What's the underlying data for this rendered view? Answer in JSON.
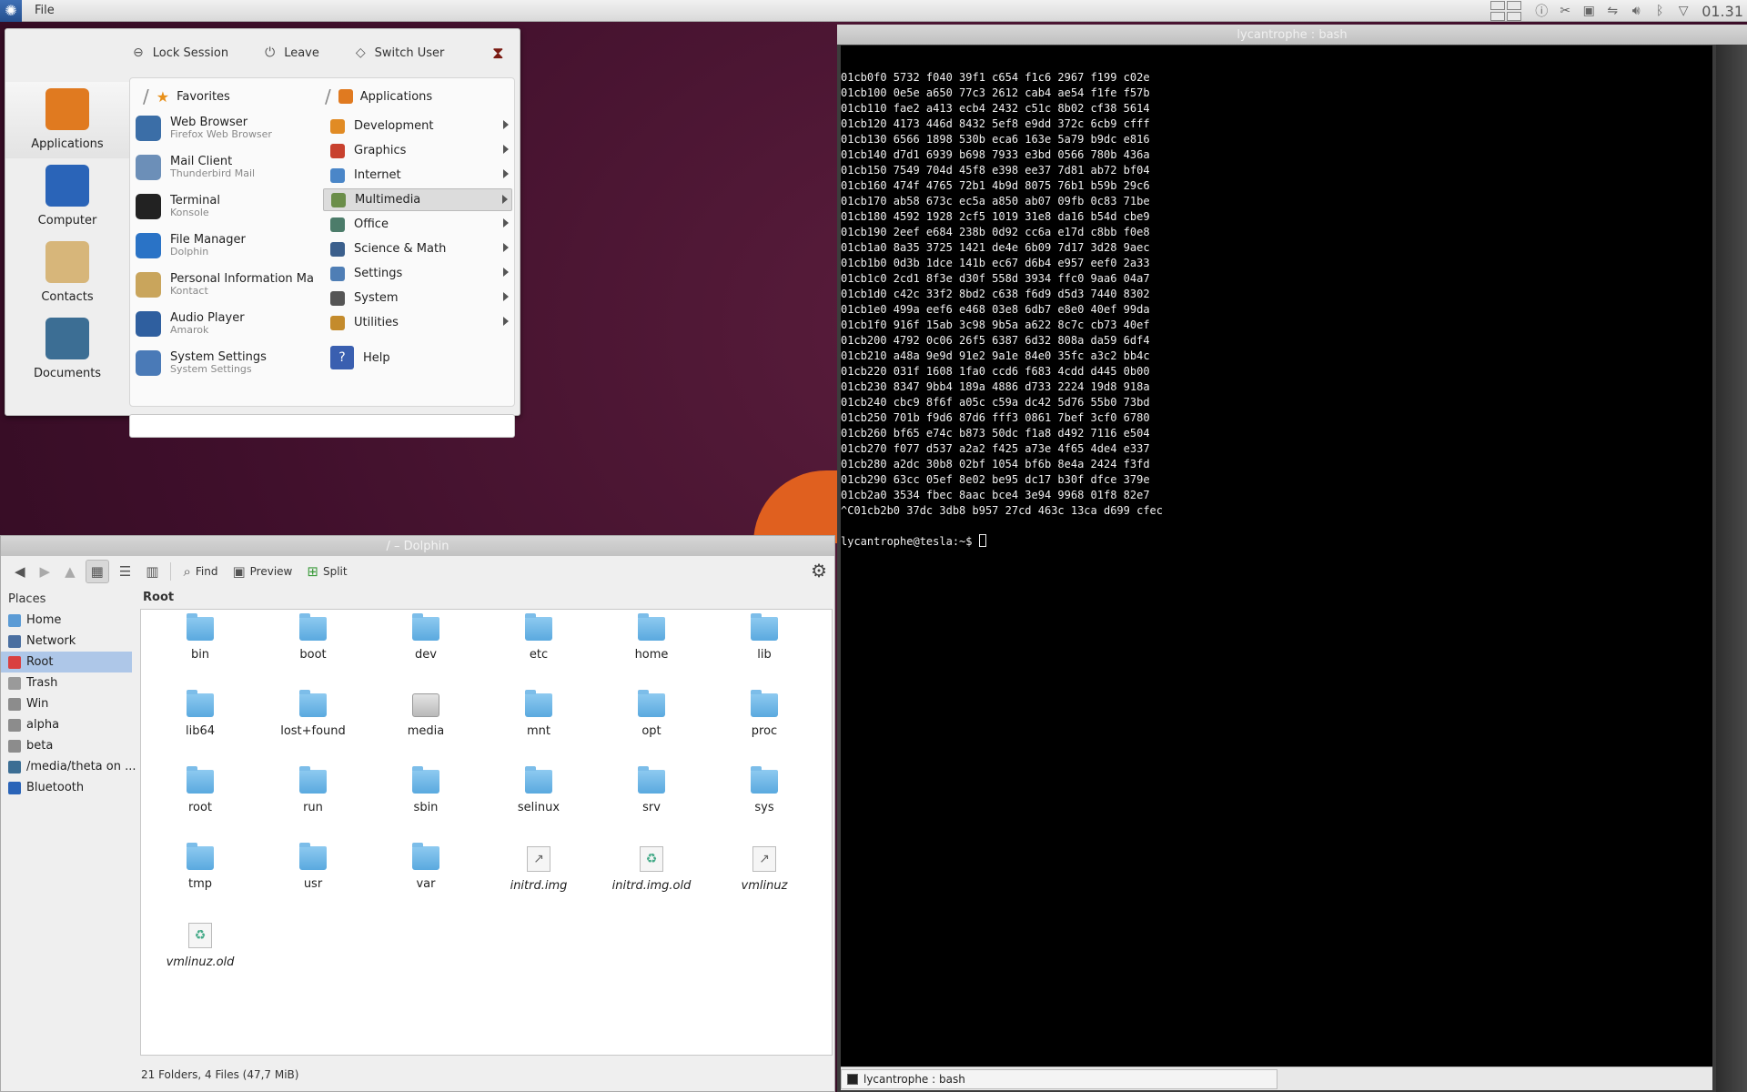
{
  "panel": {
    "file_menu": "File",
    "clock": "01.31"
  },
  "kickoff": {
    "actions": [
      "Lock Session",
      "Leave",
      "Switch User"
    ],
    "categories": [
      {
        "label": "Applications",
        "icon": "gears-icon",
        "color": "#e07a20"
      },
      {
        "label": "Computer",
        "icon": "computer-icon",
        "color": "#2a64b8"
      },
      {
        "label": "Contacts",
        "icon": "contacts-icon",
        "color": "#d7b67a"
      },
      {
        "label": "Documents",
        "icon": "documents-icon",
        "color": "#3c6e94"
      }
    ],
    "favorites_header": "Favorites",
    "applications_header": "Applications",
    "favorites": [
      {
        "name": "Web Browser",
        "sub": "Firefox Web Browser",
        "color": "#3b6ea7"
      },
      {
        "name": "Mail Client",
        "sub": "Thunderbird Mail",
        "color": "#6c8fb8"
      },
      {
        "name": "Terminal",
        "sub": "Konsole",
        "color": "#222222"
      },
      {
        "name": "File Manager",
        "sub": "Dolphin",
        "color": "#2a73c6"
      },
      {
        "name": "Personal Information Ma",
        "sub": "Kontact",
        "color": "#c9a55c"
      },
      {
        "name": "Audio Player",
        "sub": "Amarok",
        "color": "#2f5f9f"
      },
      {
        "name": "System Settings",
        "sub": "System Settings",
        "color": "#4a7ab7"
      }
    ],
    "app_categories": [
      {
        "label": "Development",
        "color": "#e18b24"
      },
      {
        "label": "Graphics",
        "color": "#c8412e"
      },
      {
        "label": "Internet",
        "color": "#4a86c8"
      },
      {
        "label": "Multimedia",
        "color": "#6b8e4a"
      },
      {
        "label": "Office",
        "color": "#4c7c6a"
      },
      {
        "label": "Science & Math",
        "color": "#3b5f8c"
      },
      {
        "label": "Settings",
        "color": "#4f7eb5"
      },
      {
        "label": "System",
        "color": "#555555"
      },
      {
        "label": "Utilities",
        "color": "#c48b2c"
      }
    ],
    "help": "Help"
  },
  "terminal": {
    "title": "lycantrophe : bash",
    "lines": [
      "01cb0f0 5732 f040 39f1 c654 f1c6 2967 f199 c02e",
      "01cb100 0e5e a650 77c3 2612 cab4 ae54 f1fe f57b",
      "01cb110 fae2 a413 ecb4 2432 c51c 8b02 cf38 5614",
      "01cb120 4173 446d 8432 5ef8 e9dd 372c 6cb9 cfff",
      "01cb130 6566 1898 530b eca6 163e 5a79 b9dc e816",
      "01cb140 d7d1 6939 b698 7933 e3bd 0566 780b 436a",
      "01cb150 7549 704d 45f8 e398 ee37 7d81 ab72 bf04",
      "01cb160 474f 4765 72b1 4b9d 8075 76b1 b59b 29c6",
      "01cb170 ab58 673c ec5a a850 ab07 09fb 0c83 71be",
      "01cb180 4592 1928 2cf5 1019 31e8 da16 b54d cbe9",
      "01cb190 2eef e684 238b 0d92 cc6a e17d c8bb f0e8",
      "01cb1a0 8a35 3725 1421 de4e 6b09 7d17 3d28 9aec",
      "01cb1b0 0d3b 1dce 141b ec67 d6b4 e957 eef0 2a33",
      "01cb1c0 2cd1 8f3e d30f 558d 3934 ffc0 9aa6 04a7",
      "01cb1d0 c42c 33f2 8bd2 c638 f6d9 d5d3 7440 8302",
      "01cb1e0 499a eef6 e468 03e8 6db7 e8e0 40ef 99da",
      "01cb1f0 916f 15ab 3c98 9b5a a622 8c7c cb73 40ef",
      "01cb200 4792 0c06 26f5 6387 6d32 808a da59 6df4",
      "01cb210 a48a 9e9d 91e2 9a1e 84e0 35fc a3c2 bb4c",
      "01cb220 031f 1608 1fa0 ccd6 f683 4cdd d445 0b00",
      "01cb230 8347 9bb4 189a 4886 d733 2224 19d8 918a",
      "01cb240 cbc9 8f6f a05c c59a dc42 5d76 55b0 73bd",
      "01cb250 701b f9d6 87d6 fff3 0861 7bef 3cf0 6780",
      "01cb260 bf65 e74c b873 50dc f1a8 d492 7116 e504",
      "01cb270 f077 d537 a2a2 f425 a73e 4f65 4de4 e337",
      "01cb280 a2dc 30b8 02bf 1054 bf6b 8e4a 2424 f3fd",
      "01cb290 63cc 05ef 8e02 be95 dc17 b30f dfce 379e",
      "01cb2a0 3534 fbec 8aac bce4 3e94 9968 01f8 82e7",
      "^C01cb2b0 37dc 3db8 b957 27cd 463c 13ca d699 cfec"
    ],
    "prompt": "lycantrophe@tesla:~$ ",
    "tab": "lycantrophe : bash"
  },
  "dolphin": {
    "title": "/ – Dolphin",
    "toolbar": {
      "find": "Find",
      "preview": "Preview",
      "split": "Split"
    },
    "places_header": "Places",
    "places": [
      {
        "label": "Home",
        "color": "#5b9bd5"
      },
      {
        "label": "Network",
        "color": "#4a6fa0"
      },
      {
        "label": "Root",
        "color": "#d94040"
      },
      {
        "label": "Trash",
        "color": "#9a9a9a"
      },
      {
        "label": "Win",
        "color": "#8c8c8c"
      },
      {
        "label": "alpha",
        "color": "#8c8c8c"
      },
      {
        "label": "beta",
        "color": "#8c8c8c"
      },
      {
        "label": "/media/theta on ...",
        "color": "#3c6e94"
      },
      {
        "label": "Bluetooth",
        "color": "#2a64b8"
      }
    ],
    "breadcrumb": "Root",
    "items": [
      {
        "name": "bin",
        "kind": "folder"
      },
      {
        "name": "boot",
        "kind": "folder"
      },
      {
        "name": "dev",
        "kind": "folder"
      },
      {
        "name": "etc",
        "kind": "folder"
      },
      {
        "name": "home",
        "kind": "folder"
      },
      {
        "name": "lib",
        "kind": "folder"
      },
      {
        "name": "lib64",
        "kind": "folder"
      },
      {
        "name": "lost+found",
        "kind": "folder"
      },
      {
        "name": "media",
        "kind": "drive"
      },
      {
        "name": "mnt",
        "kind": "folder"
      },
      {
        "name": "opt",
        "kind": "folder"
      },
      {
        "name": "proc",
        "kind": "folder"
      },
      {
        "name": "root",
        "kind": "folder"
      },
      {
        "name": "run",
        "kind": "folder"
      },
      {
        "name": "sbin",
        "kind": "folder"
      },
      {
        "name": "selinux",
        "kind": "folder"
      },
      {
        "name": "srv",
        "kind": "folder"
      },
      {
        "name": "sys",
        "kind": "folder"
      },
      {
        "name": "tmp",
        "kind": "folder"
      },
      {
        "name": "usr",
        "kind": "folder"
      },
      {
        "name": "var",
        "kind": "folder"
      },
      {
        "name": "initrd.img",
        "kind": "link"
      },
      {
        "name": "initrd.img.old",
        "kind": "link-recycle"
      },
      {
        "name": "vmlinuz",
        "kind": "link"
      },
      {
        "name": "vmlinuz.old",
        "kind": "link-recycle"
      }
    ],
    "status": "21 Folders, 4 Files (47,7 MiB)"
  }
}
